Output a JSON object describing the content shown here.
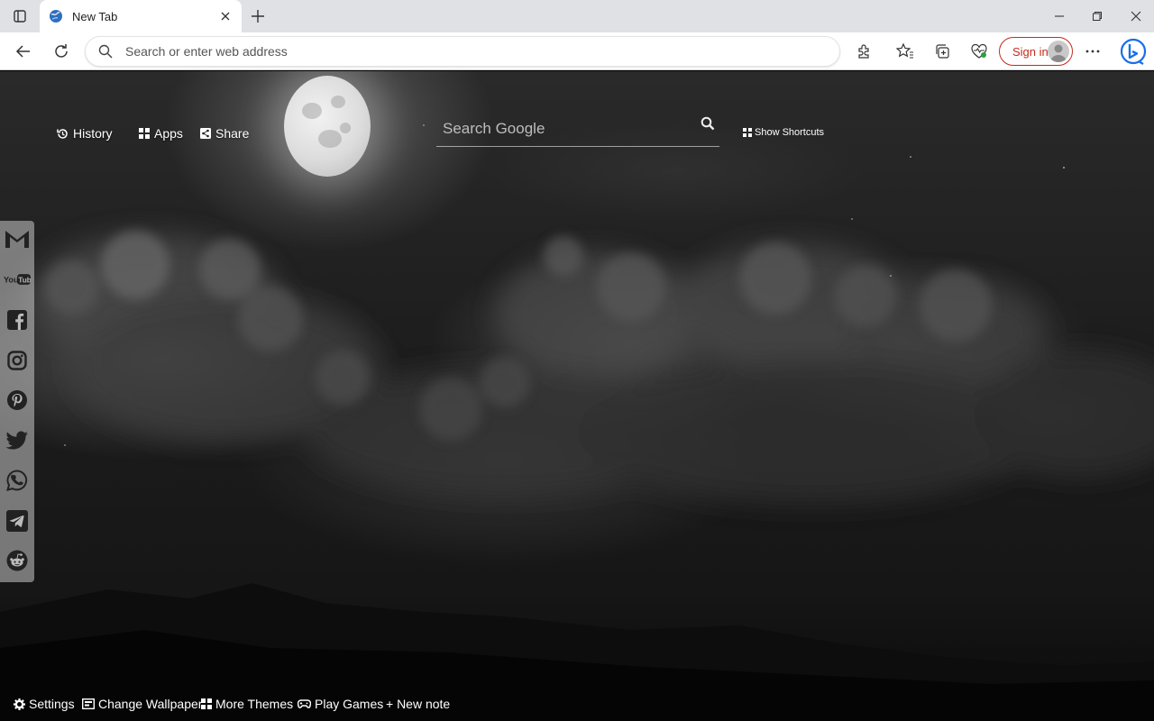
{
  "browser": {
    "tab": {
      "title": "New Tab"
    },
    "address_bar": {
      "placeholder": "Search or enter web address"
    },
    "sign_in_label": "Sign in"
  },
  "page": {
    "top_links": {
      "history": "History",
      "apps": "Apps",
      "share": "Share"
    },
    "search": {
      "placeholder": "Search Google"
    },
    "show_shortcuts": "Show Shortcuts",
    "social": [
      "gmail-icon",
      "youtube-icon",
      "facebook-icon",
      "instagram-icon",
      "pinterest-icon",
      "twitter-icon",
      "whatsapp-icon",
      "telegram-icon",
      "reddit-icon"
    ],
    "bottom_links": {
      "settings": "Settings",
      "change_wallpaper": "Change Wallpaper",
      "more_themes": "More Themes",
      "play_games": "Play Games",
      "new_note": "+ New note"
    }
  },
  "colors": {
    "accent_signin": "#c42b1c",
    "bing_blue": "#1b6ee8",
    "text_on_wallpaper": "#ffffff"
  }
}
